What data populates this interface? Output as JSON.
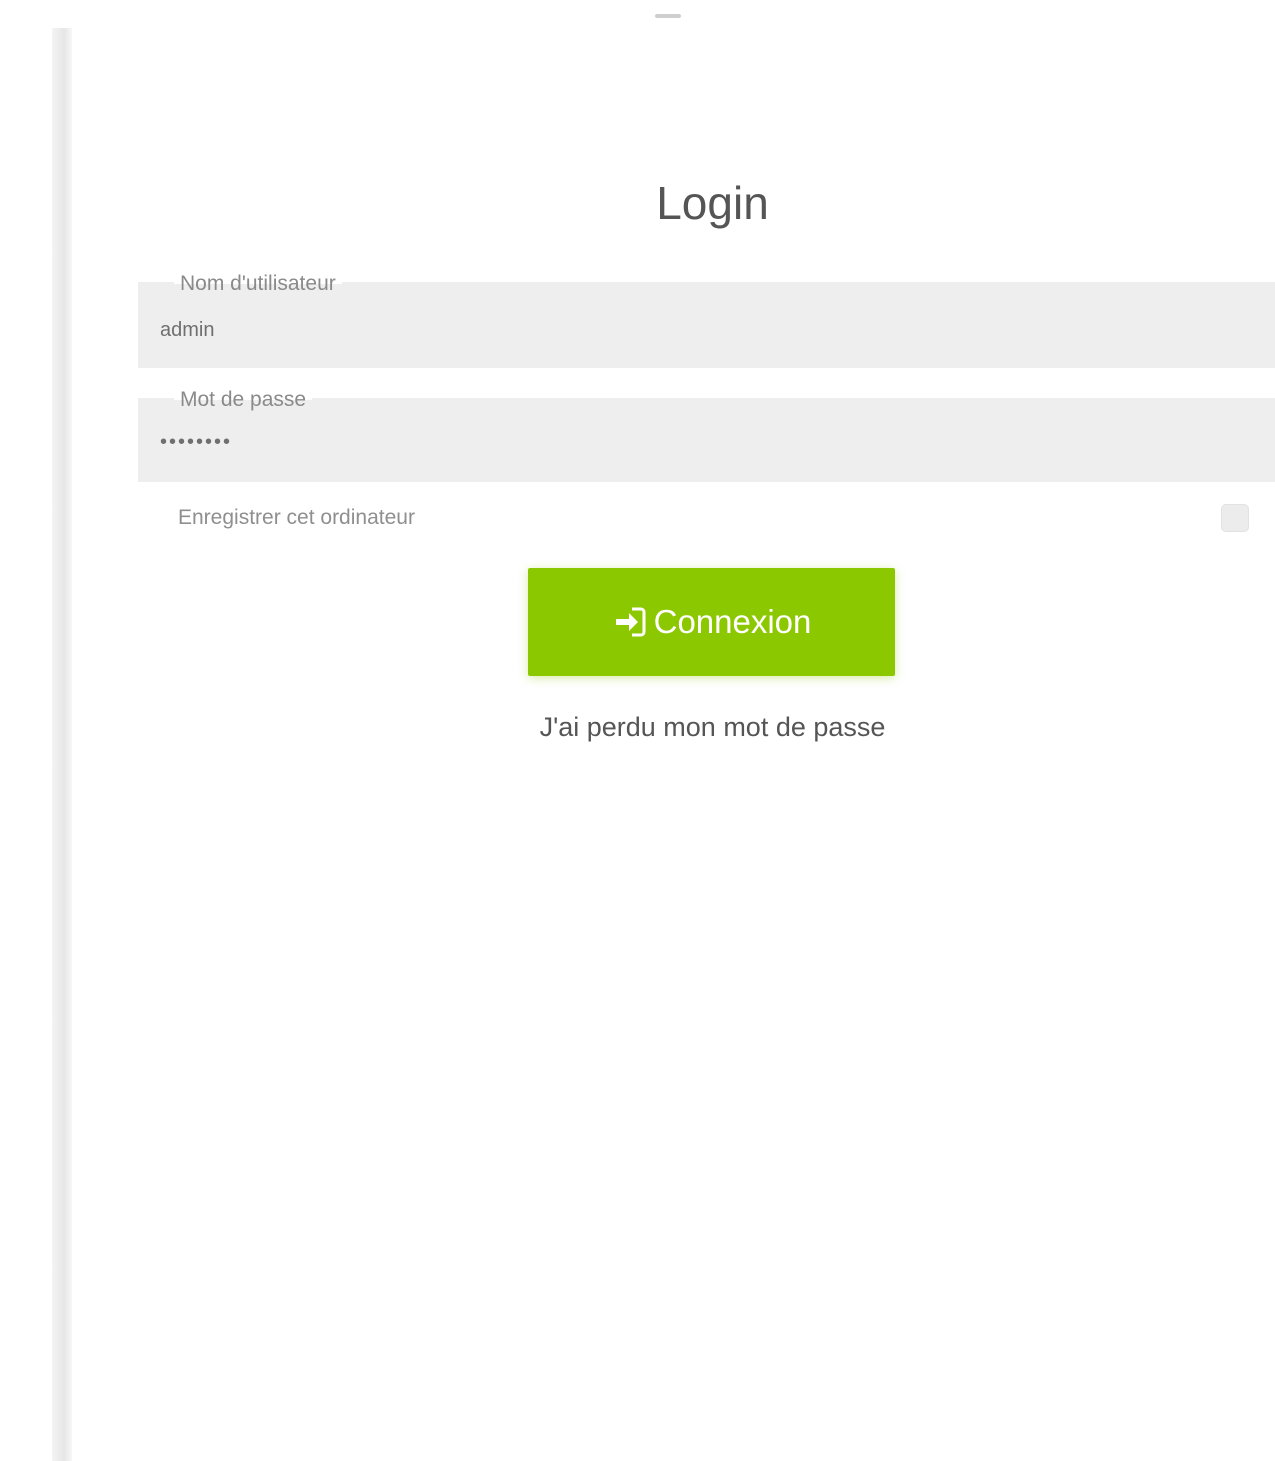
{
  "page": {
    "title": "Login"
  },
  "form": {
    "username": {
      "label": "Nom d'utilisateur",
      "value": "admin"
    },
    "password": {
      "label": "Mot de passe",
      "value": "••••••••"
    },
    "remember": {
      "label": "Enregistrer cet ordinateur",
      "checked": false
    },
    "submit_label": "Connexion",
    "submit_icon": "sign-in-icon",
    "forgot_label": "J'ai perdu mon mot de passe"
  },
  "colors": {
    "accent": "#8cc800",
    "field_background": "#eeeeee"
  }
}
